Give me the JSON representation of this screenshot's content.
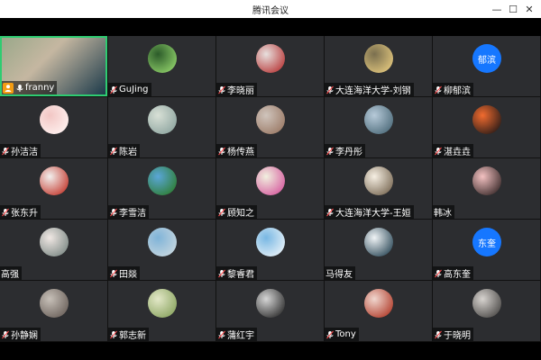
{
  "window": {
    "title": "腾讯会议",
    "minimize": "—",
    "maximize": "☐",
    "close": "✕"
  },
  "participants": [
    {
      "name": "franny",
      "selected": true,
      "host": true,
      "avatar": {
        "type": "video",
        "colors": [
          "#9aa88a",
          "#1c3a4a",
          "#c5b7a1"
        ]
      }
    },
    {
      "name": "GuJing",
      "avatar": {
        "type": "img",
        "colors": [
          "#2c5b2a",
          "#8fcf6a"
        ]
      }
    },
    {
      "name": "李晓丽",
      "avatar": {
        "type": "img",
        "colors": [
          "#e7e0de",
          "#b83a3a"
        ]
      }
    },
    {
      "name": "大连海洋大学-刘钢",
      "avatar": {
        "type": "img",
        "colors": [
          "#7a6f4f",
          "#e1c67d"
        ]
      }
    },
    {
      "name": "柳郁滨",
      "avatar": {
        "type": "text",
        "text": "郁滨",
        "bg": "#1677ff"
      }
    },
    {
      "name": "孙洁洁",
      "avatar": {
        "type": "img",
        "colors": [
          "#f2c6c4",
          "#fff2f0"
        ]
      }
    },
    {
      "name": "陈岩",
      "avatar": {
        "type": "img",
        "colors": [
          "#d8e0d6",
          "#8ea5a0"
        ]
      }
    },
    {
      "name": "杨传燕",
      "avatar": {
        "type": "img",
        "colors": [
          "#cfc4bc",
          "#9b7a66"
        ]
      }
    },
    {
      "name": "李丹彤",
      "avatar": {
        "type": "img",
        "colors": [
          "#b7cad9",
          "#4d6b7a"
        ]
      }
    },
    {
      "name": "湛垚垚",
      "avatar": {
        "type": "img",
        "colors": [
          "#f16b2f",
          "#2a1b17"
        ]
      }
    },
    {
      "name": "张东升",
      "avatar": {
        "type": "img",
        "colors": [
          "#f2f0ee",
          "#c43a2f"
        ]
      }
    },
    {
      "name": "李雪洁",
      "avatar": {
        "type": "img",
        "colors": [
          "#5aa6d8",
          "#2e7d32"
        ]
      }
    },
    {
      "name": "顾知之",
      "avatar": {
        "type": "img",
        "colors": [
          "#f1f0df",
          "#d65c9f"
        ]
      }
    },
    {
      "name": "大连海洋大学-王姮",
      "avatar": {
        "type": "img",
        "colors": [
          "#f6efe3",
          "#7a6a55"
        ]
      }
    },
    {
      "name": "韩冰",
      "noMic": true,
      "avatar": {
        "type": "img",
        "colors": [
          "#f3c1c1",
          "#3b2b2b"
        ]
      }
    },
    {
      "name": "高强",
      "noMic": true,
      "avatar": {
        "type": "img",
        "colors": [
          "#f0e8e4",
          "#7e8a86"
        ]
      }
    },
    {
      "name": "田燚",
      "avatar": {
        "type": "img",
        "colors": [
          "#7fb3d8",
          "#c7d7df"
        ]
      }
    },
    {
      "name": "黎睿君",
      "avatar": {
        "type": "img",
        "colors": [
          "#78b7e3",
          "#e8f2f8"
        ]
      }
    },
    {
      "name": "马得友",
      "noMic": true,
      "avatar": {
        "type": "img",
        "colors": [
          "#f0f4f6",
          "#2f4b5a"
        ]
      }
    },
    {
      "name": "高东奎",
      "avatar": {
        "type": "text",
        "text": "东奎",
        "bg": "#1677ff"
      }
    },
    {
      "name": "孙静娴",
      "avatar": {
        "type": "img",
        "colors": [
          "#c7c0b8",
          "#6b615b"
        ]
      }
    },
    {
      "name": "郭志新",
      "avatar": {
        "type": "img",
        "colors": [
          "#e3e8c8",
          "#8aa460"
        ]
      }
    },
    {
      "name": "蒲红宇",
      "avatar": {
        "type": "img",
        "colors": [
          "#d6d6d6",
          "#2f2f2f"
        ]
      }
    },
    {
      "name": "Tony",
      "avatar": {
        "type": "img",
        "colors": [
          "#f0d7cf",
          "#b13d2b"
        ]
      }
    },
    {
      "name": "于晓明",
      "avatar": {
        "type": "img",
        "colors": [
          "#d7d3cf",
          "#4c4a48"
        ]
      }
    }
  ]
}
